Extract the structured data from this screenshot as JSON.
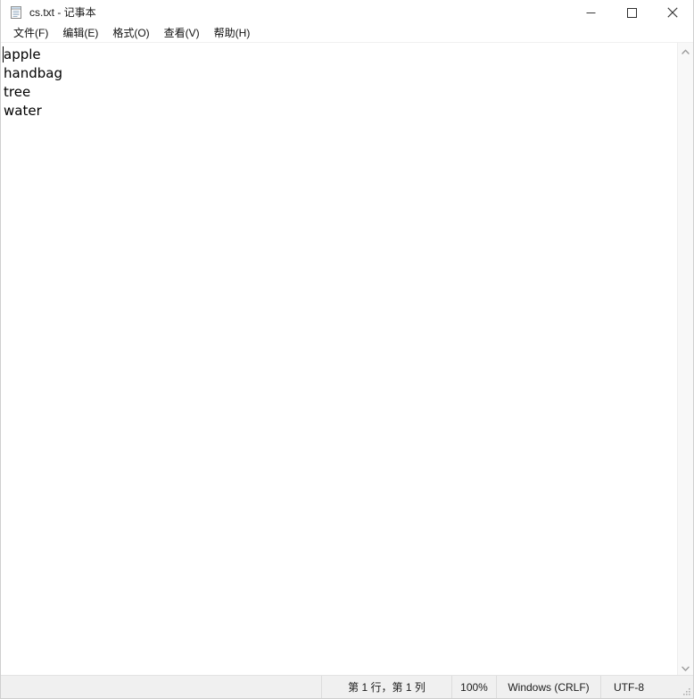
{
  "window": {
    "title": "cs.txt - 记事本",
    "app_icon": "notepad-icon"
  },
  "window_controls": {
    "minimize_label": "最小化",
    "maximize_label": "最大化",
    "close_label": "关闭"
  },
  "menubar": {
    "items": [
      {
        "label": "文件(F)"
      },
      {
        "label": "编辑(E)"
      },
      {
        "label": "格式(O)"
      },
      {
        "label": "查看(V)"
      },
      {
        "label": "帮助(H)"
      }
    ]
  },
  "editor": {
    "lines": [
      "apple",
      "handbag",
      "tree",
      "water"
    ],
    "caret_line": 1,
    "caret_column": 1
  },
  "scrollbar": {
    "up_arrow": "chevron-up-icon",
    "down_arrow": "chevron-down-icon"
  },
  "statusbar": {
    "position": "第 1 行，第 1 列",
    "zoom": "100%",
    "line_ending": "Windows (CRLF)",
    "encoding": "UTF-8"
  },
  "colors": {
    "window_bg": "#ffffff",
    "statusbar_bg": "#f0f0f0",
    "statusbar_border": "#e3e3e3",
    "divider": "#dcdcdc",
    "text": "#000000",
    "scrollbar_track": "#f8f8f8"
  }
}
